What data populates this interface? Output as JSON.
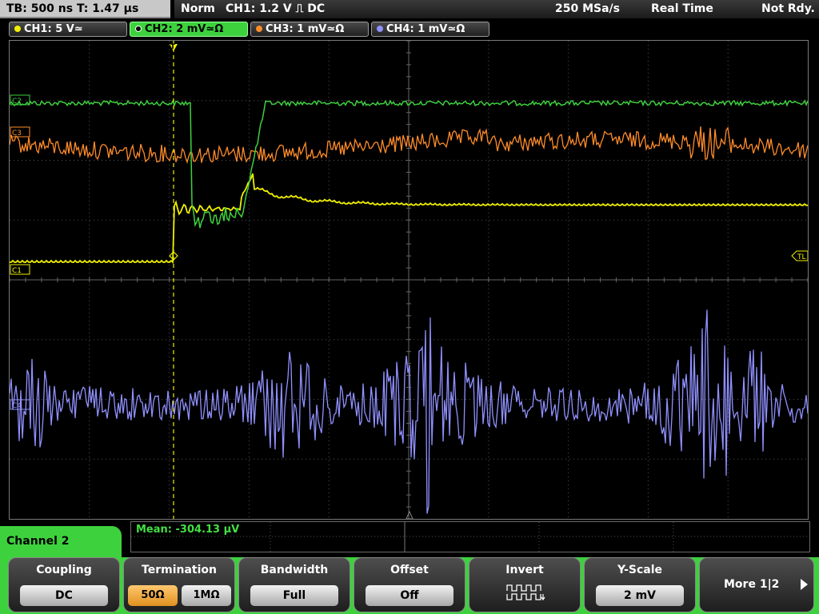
{
  "topbar": {
    "timebase": "TB: 500 ns   T: 1.47 µs",
    "trigger_mode": "Norm",
    "trigger_info": "CH1: 1.2 V ⎍ DC",
    "sample_rate": "250 MSa/s",
    "acq_mode": "Real Time",
    "status": "Not Rdy."
  },
  "channels": [
    {
      "label": "CH1: 5 V≃",
      "color": "#f0f000"
    },
    {
      "label": "CH2: 2 mV≃Ω",
      "color": "#3ed13e"
    },
    {
      "label": "CH3: 1 mV≃Ω",
      "color": "#ff8c2a"
    },
    {
      "label": "CH4: 1 mV≃Ω",
      "color": "#9090ff"
    }
  ],
  "markers": {
    "ch1": "C1",
    "ch2": "C2",
    "ch3": "C3",
    "ch4": "C4",
    "trigger_level": "TL",
    "trigger_pos": "T"
  },
  "measurement": {
    "text": "Mean: -304.13 µV"
  },
  "menu": {
    "title": "Channel 2",
    "coupling": {
      "title": "Coupling",
      "value": "DC"
    },
    "termination": {
      "title": "Termination",
      "opt1": "50Ω",
      "opt2": "1MΩ"
    },
    "bandwidth": {
      "title": "Bandwidth",
      "value": "Full"
    },
    "offset": {
      "title": "Offset",
      "value": "Off"
    },
    "invert": {
      "title": "Invert"
    },
    "yscale": {
      "title": "Y-Scale",
      "value": "2 mV"
    },
    "more": {
      "label": "More 1|2"
    }
  },
  "colors": {
    "ch1": "#f0f000",
    "ch2": "#3ed13e",
    "ch3": "#ff8c2a",
    "ch4": "#9090ff",
    "grid": "#555555"
  },
  "icons": {
    "invert": "square-wave-icon",
    "more": "arrow-right-icon"
  }
}
